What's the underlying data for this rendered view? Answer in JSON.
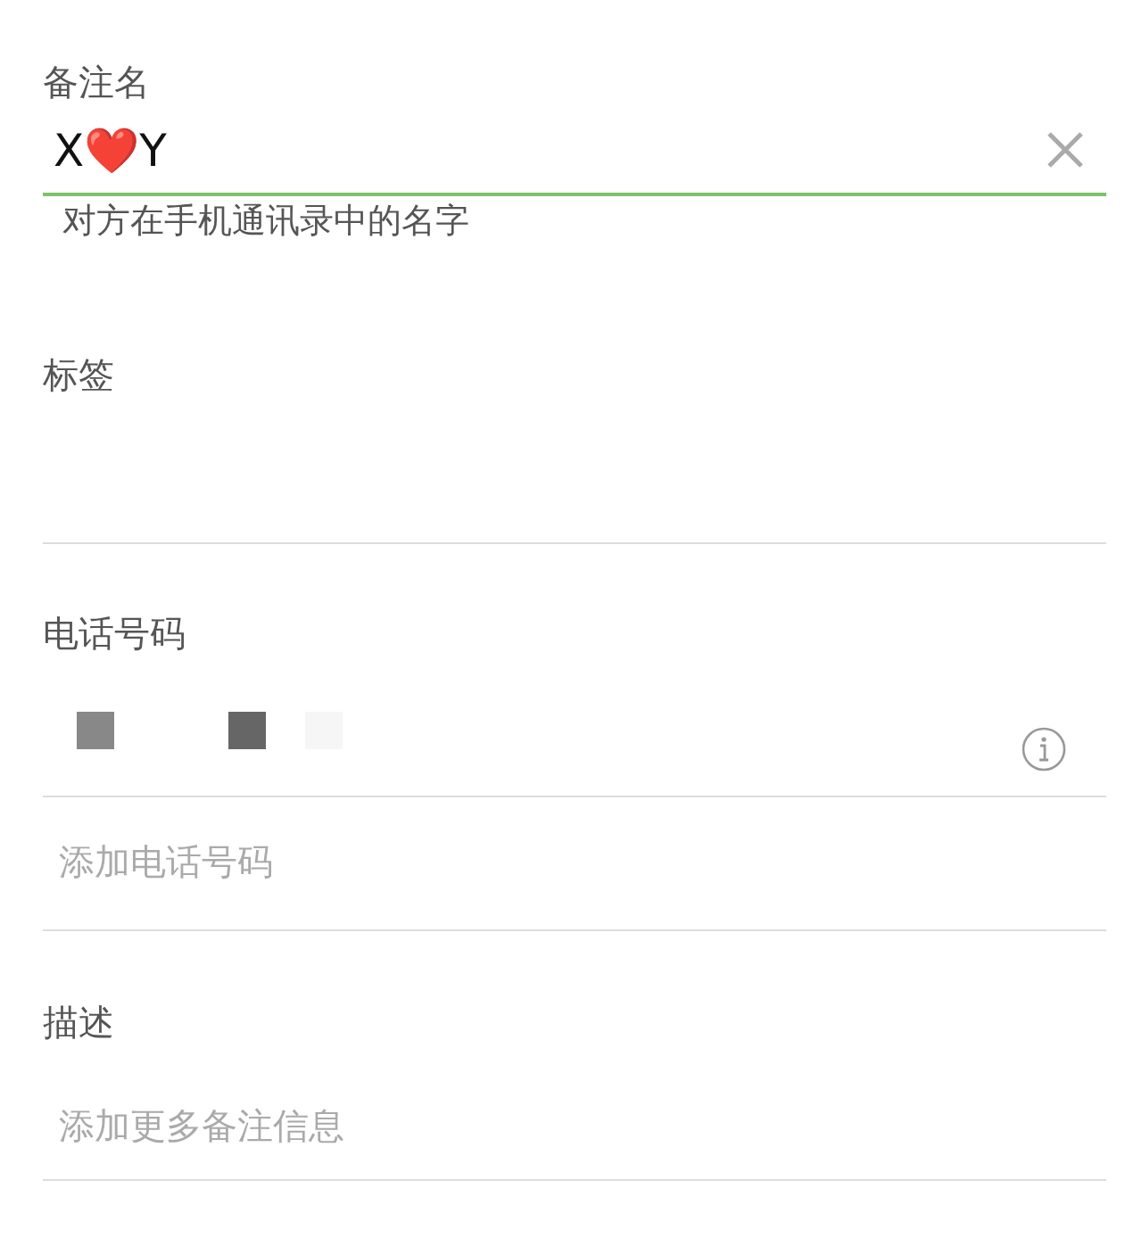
{
  "remark_name": {
    "label": "备注名",
    "value": "X❤️Y",
    "focused": true,
    "hint": "对方在手机通讯录中的名字"
  },
  "tags": {
    "label": "标签"
  },
  "phone": {
    "label": "电话号码",
    "add_placeholder": "添加电话号码"
  },
  "description": {
    "label": "描述",
    "placeholder": "添加更多备注信息"
  }
}
